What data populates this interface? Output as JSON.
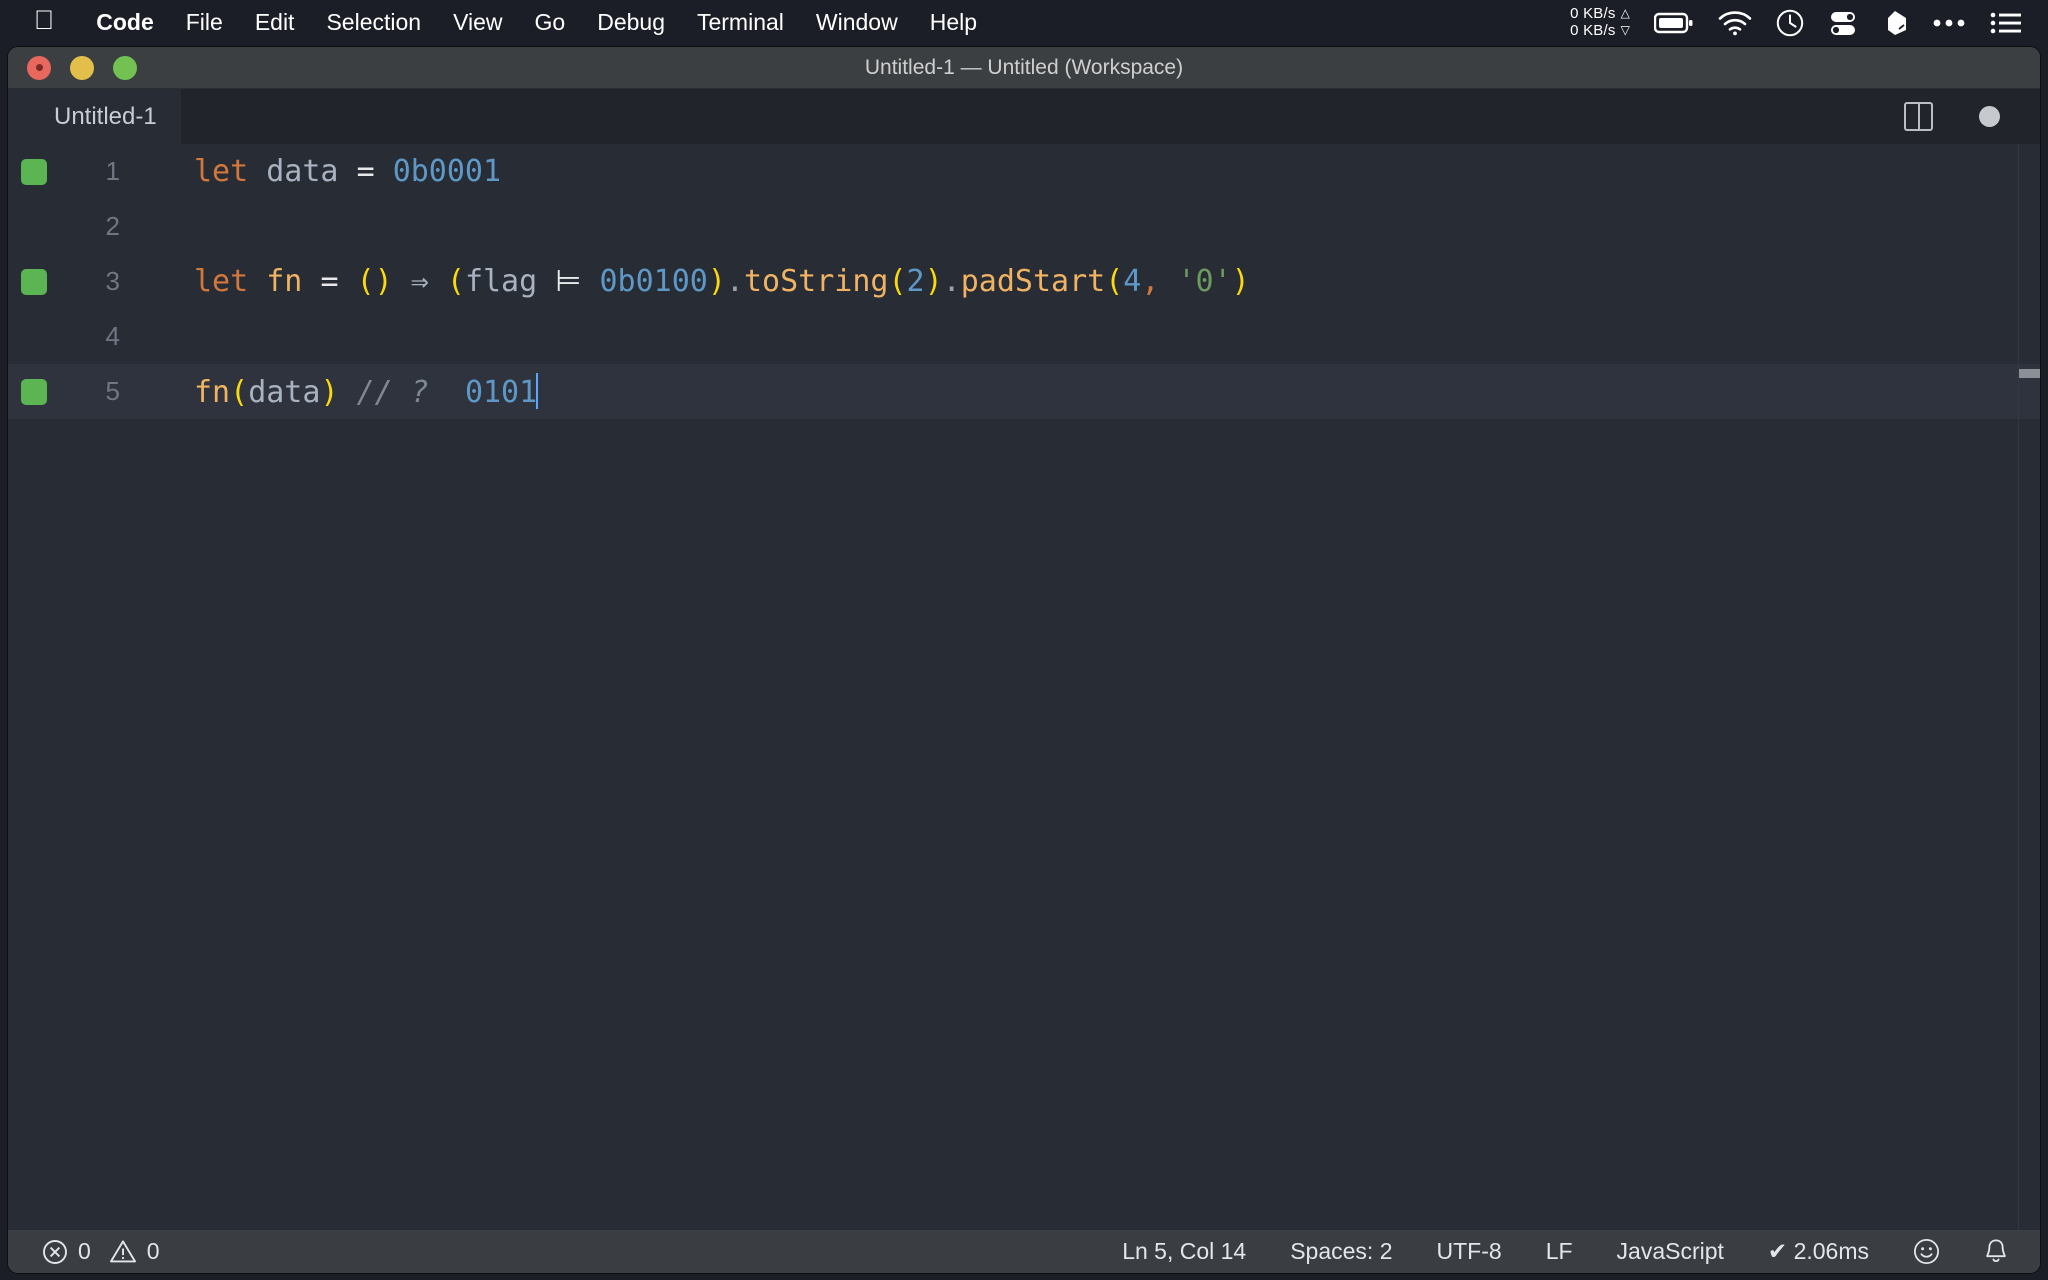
{
  "menubar": {
    "apple_icon": "apple-logo-icon",
    "items": [
      {
        "label": "Code",
        "bold": true
      },
      {
        "label": "File",
        "bold": false
      },
      {
        "label": "Edit",
        "bold": false
      },
      {
        "label": "Selection",
        "bold": false
      },
      {
        "label": "View",
        "bold": false
      },
      {
        "label": "Go",
        "bold": false
      },
      {
        "label": "Debug",
        "bold": false
      },
      {
        "label": "Terminal",
        "bold": false
      },
      {
        "label": "Window",
        "bold": false
      },
      {
        "label": "Help",
        "bold": false
      }
    ],
    "network": {
      "upload": "0 KB/s",
      "download": "0 KB/s",
      "up_glyph": "△",
      "down_glyph": "▽"
    },
    "status_icons": [
      "battery-icon",
      "wifi-icon",
      "clock-icon",
      "toggles-icon",
      "shape-icon",
      "ellipsis-icon",
      "list-menu-icon"
    ]
  },
  "window": {
    "title": "Untitled-1 — Untitled (Workspace)",
    "traffic_lights": [
      "close-button",
      "minimize-button",
      "zoom-button"
    ]
  },
  "tab": {
    "label": "Untitled-1",
    "split_editor_label": "split-editor",
    "dirty_indicator_label": "unsaved-changes"
  },
  "editor": {
    "language": "JavaScript",
    "lines": [
      {
        "number": "1",
        "has_run_marker": true,
        "active": false,
        "tokens": [
          {
            "text": "let",
            "cls": "t-kw"
          },
          {
            "text": " ",
            "cls": "t-op"
          },
          {
            "text": "data",
            "cls": "t-var"
          },
          {
            "text": " ",
            "cls": "t-op"
          },
          {
            "text": "=",
            "cls": "t-op"
          },
          {
            "text": " ",
            "cls": "t-op"
          },
          {
            "text": "0b0001",
            "cls": "t-num"
          }
        ]
      },
      {
        "number": "2",
        "has_run_marker": false,
        "active": false,
        "tokens": []
      },
      {
        "number": "3",
        "has_run_marker": true,
        "active": false,
        "tokens": [
          {
            "text": "let",
            "cls": "t-kw"
          },
          {
            "text": " ",
            "cls": "t-op"
          },
          {
            "text": "fn",
            "cls": "t-fn"
          },
          {
            "text": " ",
            "cls": "t-op"
          },
          {
            "text": "=",
            "cls": "t-op"
          },
          {
            "text": " ",
            "cls": "t-op"
          },
          {
            "text": "()",
            "cls": "t-paren"
          },
          {
            "text": " ",
            "cls": "t-op"
          },
          {
            "text": "⇒",
            "cls": "t-arrow"
          },
          {
            "text": " ",
            "cls": "t-op"
          },
          {
            "text": "(",
            "cls": "t-paren"
          },
          {
            "text": "flag",
            "cls": "t-var"
          },
          {
            "text": " ",
            "cls": "t-op"
          },
          {
            "text": "⊨",
            "cls": "t-op"
          },
          {
            "text": " ",
            "cls": "t-op"
          },
          {
            "text": "0b0100",
            "cls": "t-num"
          },
          {
            "text": ")",
            "cls": "t-paren"
          },
          {
            "text": ".",
            "cls": "t-dot"
          },
          {
            "text": "toString",
            "cls": "t-fn"
          },
          {
            "text": "(",
            "cls": "t-paren"
          },
          {
            "text": "2",
            "cls": "t-num"
          },
          {
            "text": ")",
            "cls": "t-paren"
          },
          {
            "text": ".",
            "cls": "t-dot"
          },
          {
            "text": "padStart",
            "cls": "t-fn"
          },
          {
            "text": "(",
            "cls": "t-paren"
          },
          {
            "text": "4",
            "cls": "t-num"
          },
          {
            "text": ",",
            "cls": "t-comma"
          },
          {
            "text": " ",
            "cls": "t-op"
          },
          {
            "text": "'0'",
            "cls": "t-str"
          },
          {
            "text": ")",
            "cls": "t-paren"
          }
        ]
      },
      {
        "number": "4",
        "has_run_marker": false,
        "active": false,
        "tokens": []
      },
      {
        "number": "5",
        "has_run_marker": true,
        "active": true,
        "tokens": [
          {
            "text": "fn",
            "cls": "t-fn"
          },
          {
            "text": "(",
            "cls": "t-paren"
          },
          {
            "text": "data",
            "cls": "t-var"
          },
          {
            "text": ")",
            "cls": "t-paren"
          },
          {
            "text": " ",
            "cls": "t-op"
          },
          {
            "text": "// ?",
            "cls": "t-comment"
          },
          {
            "text": "  ",
            "cls": "t-op"
          },
          {
            "text": "0101",
            "cls": "t-num"
          }
        ]
      }
    ]
  },
  "statusbar": {
    "error_icon": "error-circle-icon",
    "error_count": "0",
    "warning_icon": "warning-triangle-icon",
    "warning_count": "0",
    "cursor_position": "Ln 5, Col 14",
    "indentation": "Spaces: 2",
    "encoding": "UTF-8",
    "eol": "LF",
    "language": "JavaScript",
    "run_status": "✔ 2.06ms",
    "feedback_icon": "smiley-icon",
    "notifications_icon": "bell-icon"
  },
  "colors": {
    "menubar_bg": "#1b1e26",
    "titlebar_bg": "#3c3f41",
    "editor_bg": "#282c34",
    "tabbar_bg": "#21252b",
    "statusbar_bg": "#3a3d42",
    "run_marker": "#5ab552",
    "keyword": "#d2783c",
    "function": "#f0b263",
    "number": "#5e98c7",
    "paren": "#fcd90c",
    "string": "#6d9a60",
    "comment": "#7e8794"
  }
}
